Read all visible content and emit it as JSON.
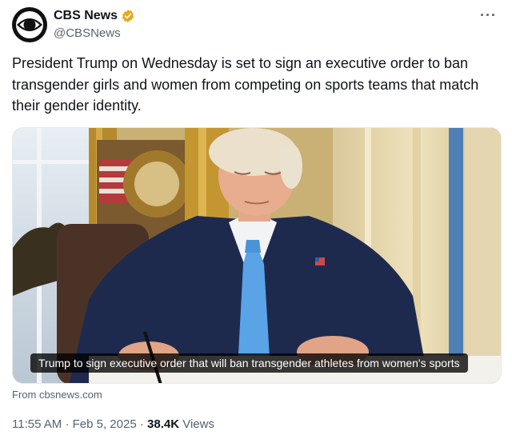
{
  "author": {
    "display_name": "CBS News",
    "handle": "@CBSNews",
    "verified_badge_icon": "verified-badge-icon",
    "badge_color": "#e8a817"
  },
  "more_label": "···",
  "tweet": {
    "text": "President Trump on Wednesday is set to sign an executive order to ban transgender girls and women from competing on sports teams that match their gender identity."
  },
  "card": {
    "caption": "Trump to sign executive order that will ban transgender athletes from women's sports",
    "source": "From cbsnews.com"
  },
  "meta": {
    "time": "11:55 AM",
    "separator": "·",
    "date": "Feb 5, 2025",
    "views_count": "38.4K",
    "views_label": "Views"
  }
}
